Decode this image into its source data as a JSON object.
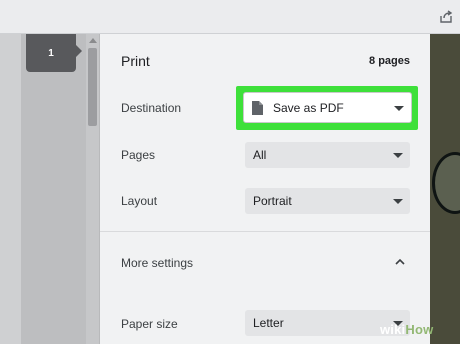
{
  "print_panel": {
    "title": "Print",
    "page_count": "8 pages",
    "destination": {
      "label": "Destination",
      "value": "Save as PDF"
    },
    "pages": {
      "label": "Pages",
      "value": "All"
    },
    "layout": {
      "label": "Layout",
      "value": "Portrait"
    },
    "more_settings": {
      "label": "More settings"
    },
    "paper_size": {
      "label": "Paper size",
      "value": "Letter"
    }
  },
  "thumbnail": {
    "page_number": "1"
  },
  "watermark": {
    "brand_prefix": "wiki",
    "brand_suffix": "How"
  },
  "colors": {
    "highlight": "#3ee03a",
    "panel_bg": "#f1f2f3"
  },
  "icons": [
    "share-icon",
    "document-icon",
    "chevron-down-icon",
    "chevron-up-icon"
  ]
}
